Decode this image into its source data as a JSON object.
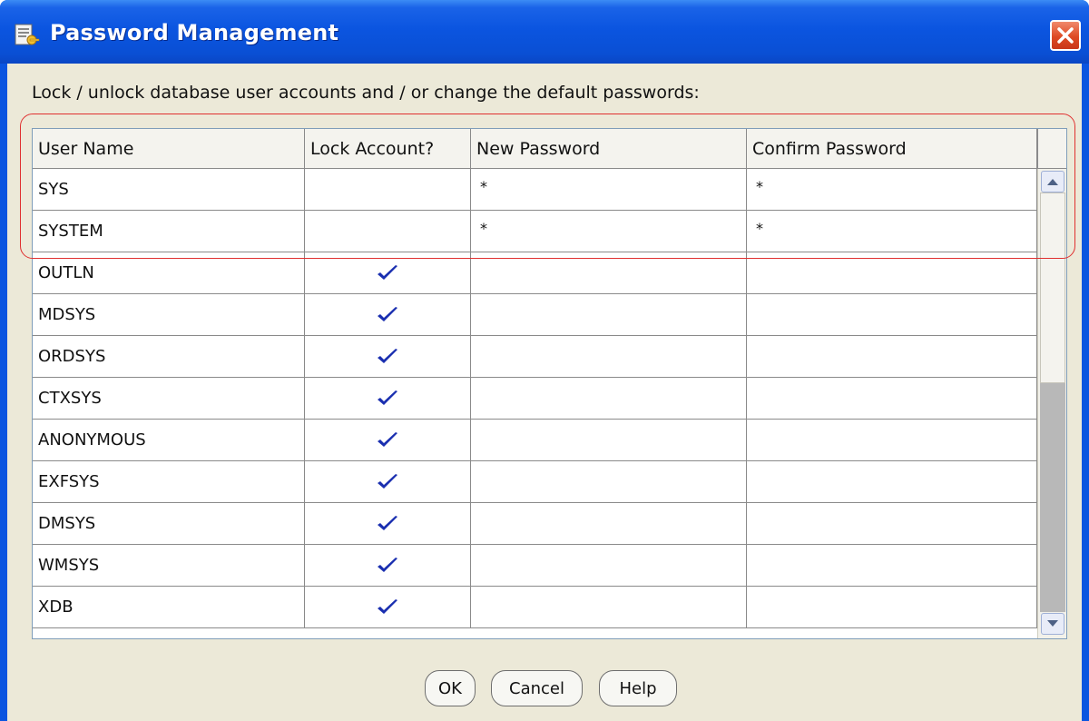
{
  "window": {
    "title": "Password Management",
    "accent": "#0b55e0",
    "close_color": "#de4a24"
  },
  "instructions": "Lock / unlock database user accounts and / or change the default passwords:",
  "table": {
    "columns": [
      "User Name",
      "Lock Account?",
      "New Password",
      "Confirm Password"
    ],
    "rows": [
      {
        "user": "SYS",
        "locked": false,
        "new_password": "*",
        "confirm_password": "*"
      },
      {
        "user": "SYSTEM",
        "locked": false,
        "new_password": "*",
        "confirm_password": "*"
      },
      {
        "user": "OUTLN",
        "locked": true,
        "new_password": "",
        "confirm_password": ""
      },
      {
        "user": "MDSYS",
        "locked": true,
        "new_password": "",
        "confirm_password": ""
      },
      {
        "user": "ORDSYS",
        "locked": true,
        "new_password": "",
        "confirm_password": ""
      },
      {
        "user": "CTXSYS",
        "locked": true,
        "new_password": "",
        "confirm_password": ""
      },
      {
        "user": "ANONYMOUS",
        "locked": true,
        "new_password": "",
        "confirm_password": ""
      },
      {
        "user": "EXFSYS",
        "locked": true,
        "new_password": "",
        "confirm_password": ""
      },
      {
        "user": "DMSYS",
        "locked": true,
        "new_password": "",
        "confirm_password": ""
      },
      {
        "user": "WMSYS",
        "locked": true,
        "new_password": "",
        "confirm_password": ""
      },
      {
        "user": "XDB",
        "locked": true,
        "new_password": "",
        "confirm_password": ""
      }
    ],
    "check_color": "#1a2fb0",
    "highlight_color": "#e03030"
  },
  "buttons": {
    "ok": "OK",
    "cancel": "Cancel",
    "help": "Help"
  },
  "icons": {
    "title": "password-management-icon",
    "close": "close-icon",
    "lock": "checkmark-icon"
  }
}
